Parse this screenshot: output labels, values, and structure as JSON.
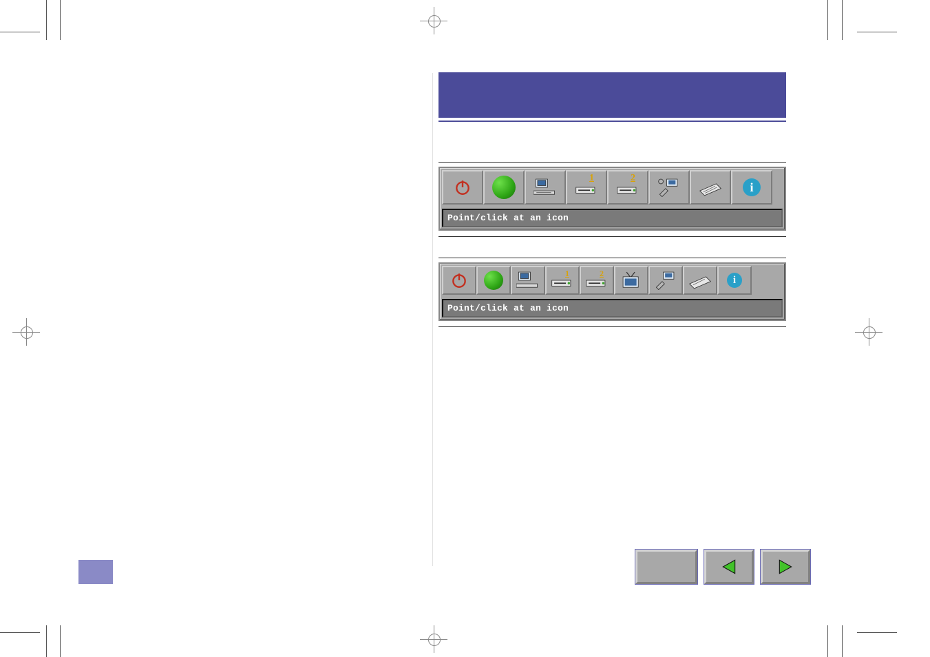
{
  "status_text1": "Point/click at an icon",
  "status_text2": "Point/click at an icon",
  "badge1": "1",
  "badge2": "2",
  "badge3": "1",
  "badge4": "2",
  "info_label": "i",
  "icons": {
    "power": "power-icon",
    "status_light": "status-light-icon",
    "computer": "computer-icon",
    "drive1": "drive-icon",
    "drive2": "drive-icon",
    "tools": "tools-icon",
    "board": "board-icon",
    "tv": "tv-icon",
    "info": "info-icon"
  }
}
